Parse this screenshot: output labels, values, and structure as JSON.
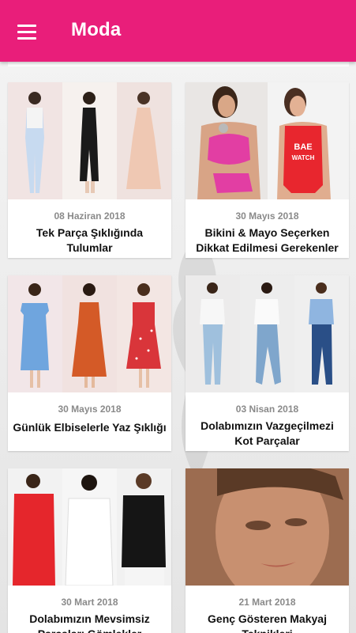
{
  "app": {
    "title": "Moda",
    "accent": "#e91e7a",
    "menu_icon": "menu-icon"
  },
  "articles": [
    {
      "date": "08 Haziran 2018",
      "title": "Tek Parça Şıklığında Tulumlar",
      "image": "three-women-jumpsuits"
    },
    {
      "date": "30 Mayıs 2018",
      "title": "Bikini & Mayo Seçerken Dikkat Edilmesi Gerekenler",
      "image": "two-women-swimsuits"
    },
    {
      "date": "30 Mayıs 2018",
      "title": "Günlük Elbiselerle Yaz Şıklığı",
      "image": "three-women-dresses"
    },
    {
      "date": "03 Nisan 2018",
      "title": "Dolabımızın Vazgeçilmezi Kot Parçalar",
      "image": "three-women-jeans"
    },
    {
      "date": "30 Mart 2018",
      "title": "Dolabımızın Mevsimsiz Parçaları Gömlekler",
      "image": "three-women-shirts"
    },
    {
      "date": "21 Mart 2018",
      "title": "Genç Gösteren Makyaj Teknikleri",
      "image": "woman-makeup-portrait"
    }
  ]
}
